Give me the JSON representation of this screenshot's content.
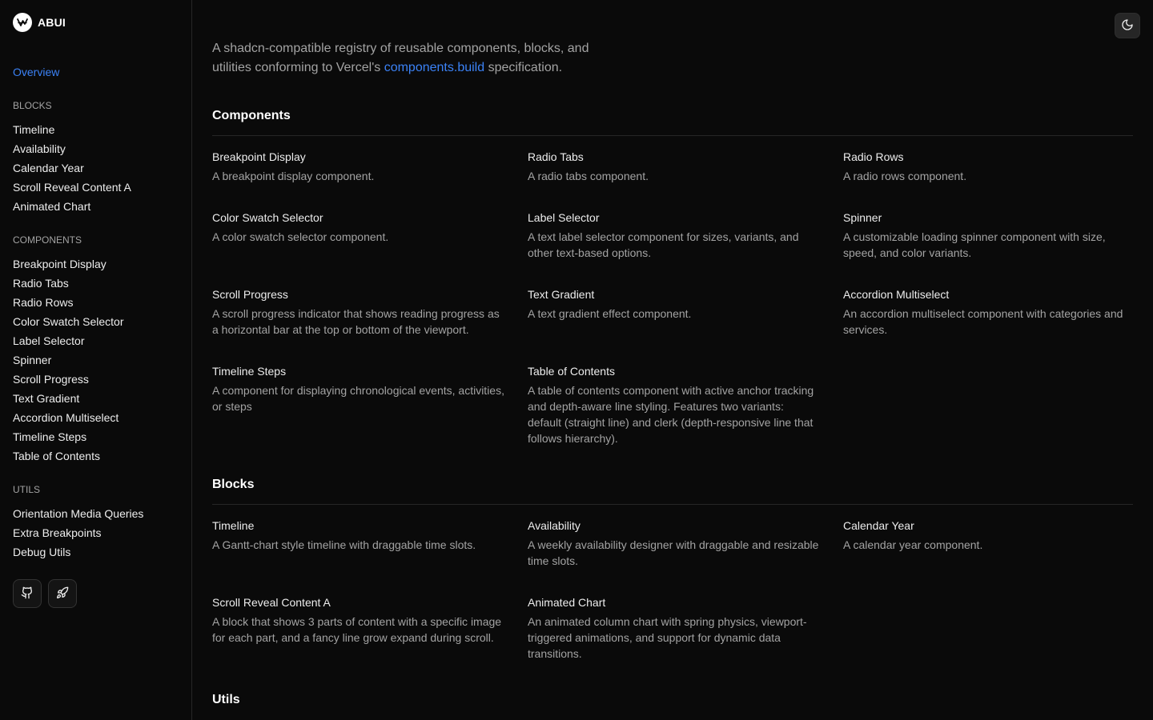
{
  "brand": {
    "name": "ABUI"
  },
  "sidebar": {
    "overview": "Overview",
    "sections": [
      {
        "heading": "BLOCKS",
        "items": [
          "Timeline",
          "Availability",
          "Calendar Year",
          "Scroll Reveal Content A",
          "Animated Chart"
        ]
      },
      {
        "heading": "COMPONENTS",
        "items": [
          "Breakpoint Display",
          "Radio Tabs",
          "Radio Rows",
          "Color Swatch Selector",
          "Label Selector",
          "Spinner",
          "Scroll Progress",
          "Text Gradient",
          "Accordion Multiselect",
          "Timeline Steps",
          "Table of Contents"
        ]
      },
      {
        "heading": "UTILS",
        "items": [
          "Orientation Media Queries",
          "Extra Breakpoints",
          "Debug Utils"
        ]
      }
    ],
    "footer_icons": [
      "github-icon",
      "rocket-icon"
    ]
  },
  "header": {
    "theme_icon": "moon-icon"
  },
  "intro": {
    "before": "A shadcn-compatible registry of reusable components, blocks, and utilities conforming to Vercel's ",
    "link": "components.build",
    "after": " specification."
  },
  "components": {
    "title": "Components",
    "cards": [
      {
        "title": "Breakpoint Display",
        "desc": "A breakpoint display component."
      },
      {
        "title": "Radio Tabs",
        "desc": "A radio tabs component."
      },
      {
        "title": "Radio Rows",
        "desc": "A radio rows component."
      },
      {
        "title": "Color Swatch Selector",
        "desc": "A color swatch selector component."
      },
      {
        "title": "Label Selector",
        "desc": "A text label selector component for sizes, variants, and other text-based options."
      },
      {
        "title": "Spinner",
        "desc": "A customizable loading spinner component with size, speed, and color variants."
      },
      {
        "title": "Scroll Progress",
        "desc": "A scroll progress indicator that shows reading progress as a horizontal bar at the top or bottom of the viewport."
      },
      {
        "title": "Text Gradient",
        "desc": "A text gradient effect component."
      },
      {
        "title": "Accordion Multiselect",
        "desc": "An accordion multiselect component with categories and services."
      },
      {
        "title": "Timeline Steps",
        "desc": "A component for displaying chronological events, activities, or steps"
      },
      {
        "title": "Table of Contents",
        "desc": "A table of contents component with active anchor tracking and depth-aware line styling. Features two variants: default (straight line) and clerk (depth-responsive line that follows hierarchy)."
      }
    ]
  },
  "blocks": {
    "title": "Blocks",
    "cards": [
      {
        "title": "Timeline",
        "desc": "A Gantt-chart style timeline with draggable time slots."
      },
      {
        "title": "Availability",
        "desc": "A weekly availability designer with draggable and resizable time slots."
      },
      {
        "title": "Calendar Year",
        "desc": "A calendar year component."
      },
      {
        "title": "Scroll Reveal Content A",
        "desc": "A block that shows 3 parts of content with a specific image for each part, and a fancy line grow expand during scroll."
      },
      {
        "title": "Animated Chart",
        "desc": "An animated column chart with spring physics, viewport-triggered animations, and support for dynamic data transitions."
      }
    ]
  },
  "utils": {
    "title": "Utils"
  }
}
